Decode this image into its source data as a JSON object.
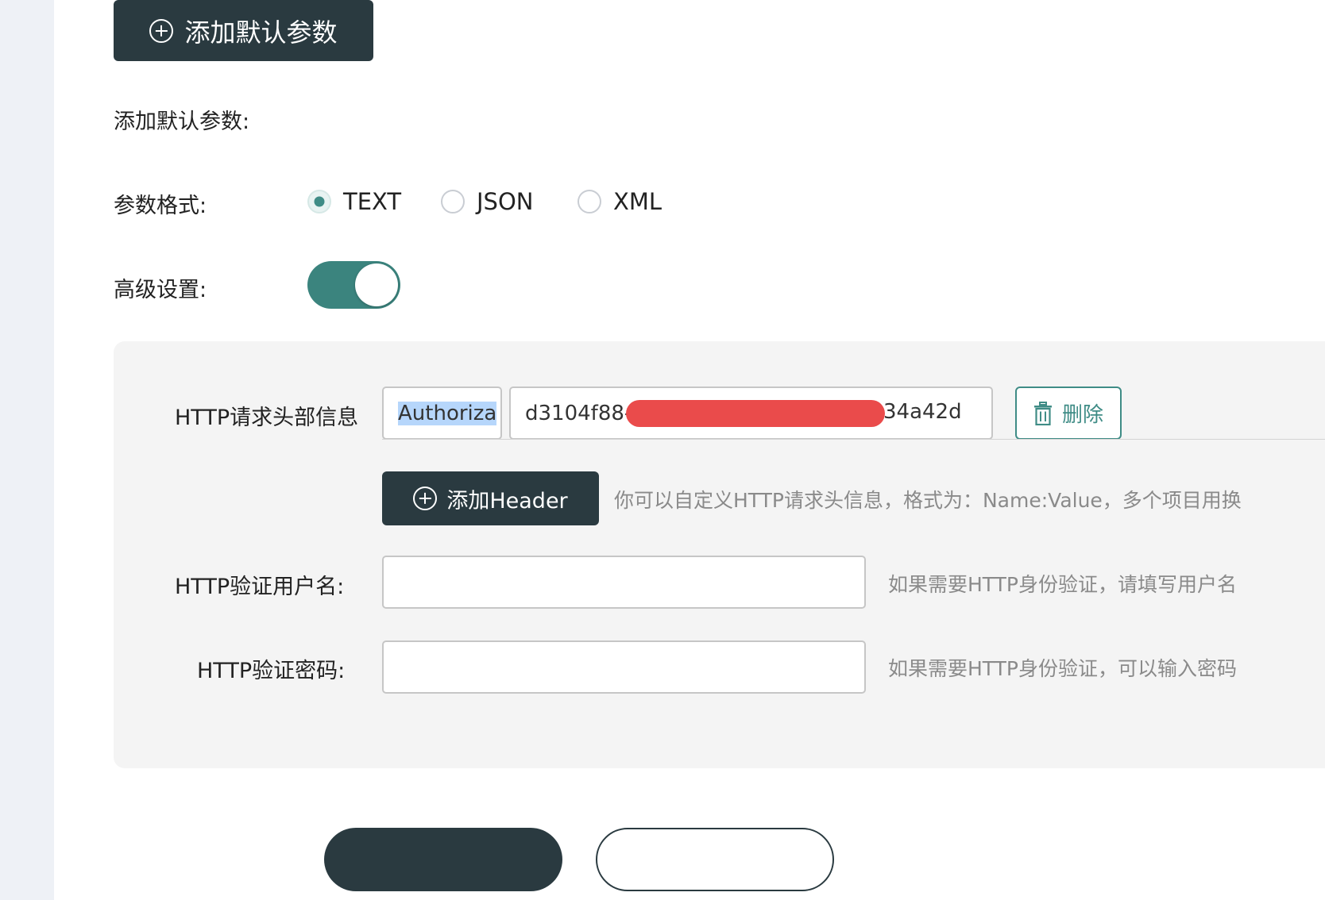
{
  "add_default_button": {
    "label": "添加默认参数"
  },
  "add_default_label": "添加默认参数:",
  "param_format": {
    "label": "参数格式:",
    "options": [
      "TEXT",
      "JSON",
      "XML"
    ],
    "selected": "TEXT"
  },
  "advanced": {
    "label": "高级设置:",
    "enabled": true
  },
  "http_headers": {
    "label": "HTTP请求头部信息",
    "name_value": "Authoriza",
    "value_prefix": "d3104f88-",
    "value_suffix": "34a42d",
    "delete_label": "删除",
    "add_label": "添加Header",
    "hint": "你可以自定义HTTP请求头信息，格式为：Name:Value，多个项目用换"
  },
  "http_username": {
    "label": "HTTP验证用户名:",
    "value": "",
    "hint": "如果需要HTTP身份验证，请填写用户名"
  },
  "http_password": {
    "label": "HTTP验证密码:",
    "value": "",
    "hint": "如果需要HTTP身份验证，可以输入密码"
  },
  "colors": {
    "accent": "#3f8c86",
    "dark_button": "#2a3a40",
    "redaction": "#ea4b4b"
  }
}
